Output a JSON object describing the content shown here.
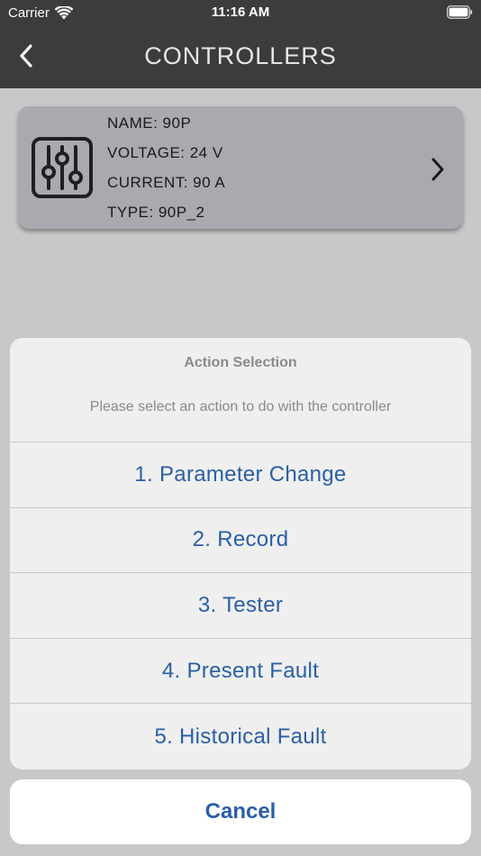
{
  "status_bar": {
    "carrier": "Carrier",
    "time": "11:16 AM",
    "icons": [
      "wifi-icon",
      "battery-icon"
    ]
  },
  "nav": {
    "title": "CONTROLLERS",
    "back_icon": "chevron-left-icon"
  },
  "controller_card": {
    "icon": "sliders-icon",
    "lines": [
      "NAME: 90P",
      "VOLTAGE: 24 V",
      "CURRENT: 90 A",
      "TYPE: 90P_2"
    ],
    "chevron_icon": "chevron-right-icon"
  },
  "action_sheet": {
    "title": "Action Selection",
    "message": "Please select an action to do with the controller",
    "actions": [
      "1. Parameter Change",
      "2. Record",
      "3. Tester",
      "4. Present Fault",
      "5. Historical Fault"
    ],
    "cancel": "Cancel"
  },
  "colors": {
    "nav_background": "#3c3c3c",
    "screen_dim": "#c8c8c8",
    "card_background": "#a9a9b0",
    "action_text": "#2a5fa6",
    "sheet_background": "#efefef"
  }
}
